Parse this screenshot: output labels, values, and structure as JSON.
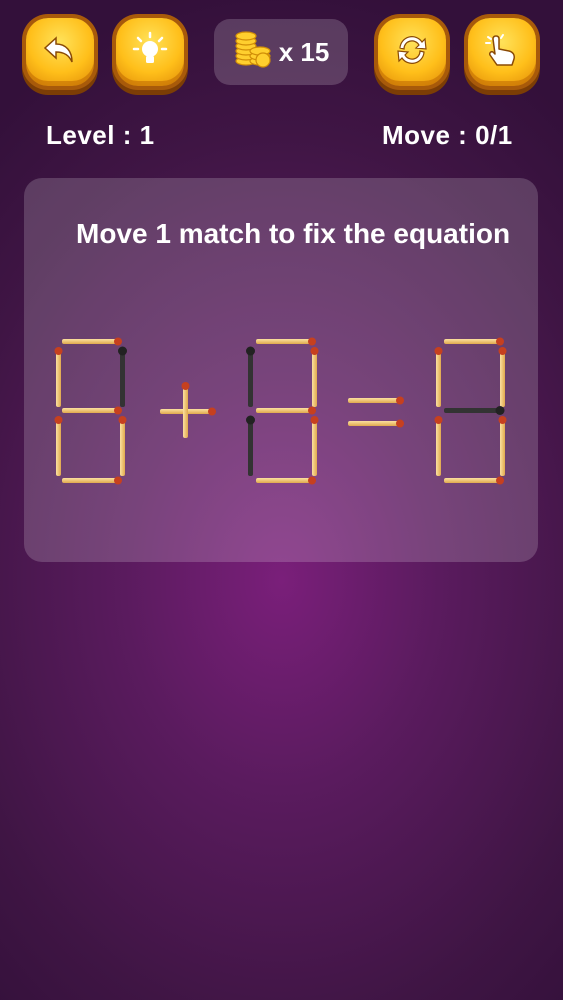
{
  "toolbar": {
    "back_icon": "undo-arrow-icon",
    "hint_icon": "lightbulb-icon",
    "restart_icon": "refresh-icon",
    "tap_icon": "hand-pointer-icon",
    "coin_icon": "coin-stack-icon",
    "coin_text": "x 15"
  },
  "status": {
    "level_text": "Level : 1",
    "move_text": "Move : 0/1"
  },
  "puzzle": {
    "instruction": "Move 1 match to fix the equation",
    "equation": "8 + 8 = 8",
    "match_color": "#f5c76c",
    "match_head_color": "#c6401f",
    "burnt_color": "#333333"
  },
  "colors": {
    "button_yellow": "#ffc21a",
    "button_rim": "#a85a0a",
    "background": "#4a1750"
  }
}
